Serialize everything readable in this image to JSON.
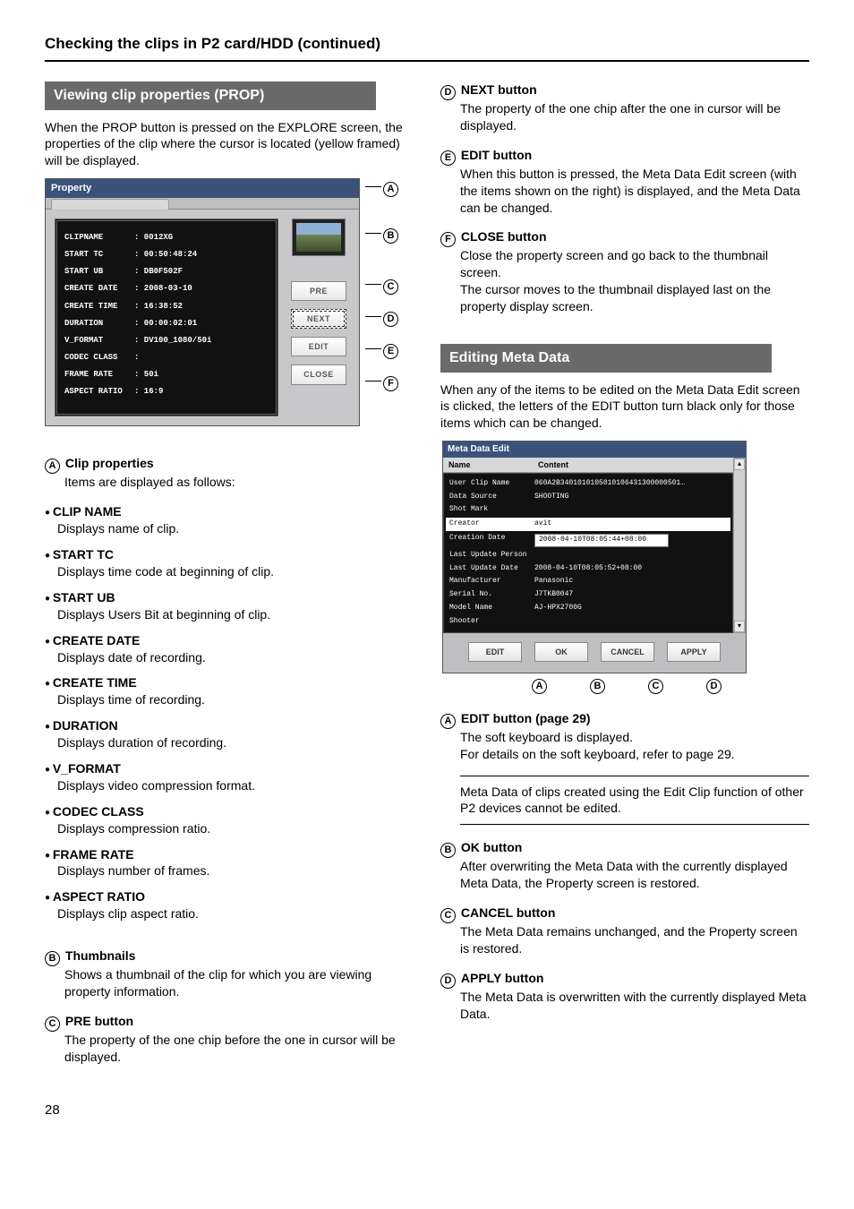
{
  "page_title": "Checking the clips in P2 card/HDD (continued)",
  "page_number": "28",
  "left": {
    "heading": "Viewing clip properties (PROP)",
    "intro": "When the PROP button is pressed on the EXPLORE screen, the properties of the clip where the cursor is located (yellow framed) will be displayed.",
    "window_title": "Property",
    "buttons": {
      "pre": "PRE",
      "next": "NEXT",
      "edit": "EDIT",
      "close": "CLOSE"
    },
    "rows": [
      {
        "k": "CLIPNAME",
        "v": ": 0012XG"
      },
      {
        "k": "START TC",
        "v": ": 00:50:48:24"
      },
      {
        "k": "START UB",
        "v": ": DB0F502F"
      },
      {
        "k": "CREATE DATE",
        "v": ": 2008-03-10"
      },
      {
        "k": "CREATE TIME",
        "v": ": 16:38:52"
      },
      {
        "k": "DURATION",
        "v": ": 00:00:02:01"
      },
      {
        "k": "V_FORMAT",
        "v": ": DV100_1080/50i"
      },
      {
        "k": "CODEC CLASS",
        "v": ":"
      },
      {
        "k": "FRAME RATE",
        "v": ": 50i"
      },
      {
        "k": "ASPECT RATIO",
        "v": ": 16:9"
      }
    ],
    "items": [
      {
        "label": "Clip properties",
        "desc": "Items are displayed as follows:"
      },
      {
        "label": "Thumbnails",
        "desc": "Shows a thumbnail of the clip for which you are viewing property information."
      },
      {
        "label": "PRE button",
        "desc": "The property of the one chip before the one in cursor will be displayed."
      }
    ],
    "props": [
      {
        "name": "CLIP NAME",
        "desc": "Displays name of clip."
      },
      {
        "name": "START TC",
        "desc": "Displays time code at beginning of clip."
      },
      {
        "name": "START UB",
        "desc": "Displays Users Bit at beginning of clip."
      },
      {
        "name": "CREATE DATE",
        "desc": "Displays date of recording."
      },
      {
        "name": "CREATE TIME",
        "desc": "Displays time of recording."
      },
      {
        "name": "DURATION",
        "desc": "Displays duration of recording."
      },
      {
        "name": "V_FORMAT",
        "desc": "Displays video compression format."
      },
      {
        "name": "CODEC CLASS",
        "desc": "Displays compression ratio."
      },
      {
        "name": "FRAME RATE",
        "desc": "Displays number of frames."
      },
      {
        "name": "ASPECT RATIO",
        "desc": "Displays clip aspect ratio."
      }
    ]
  },
  "right": {
    "d_label": "NEXT button",
    "d_desc": "The property of the one chip after the one in cursor will be displayed.",
    "e_label": "EDIT button",
    "e_desc": "When this button is pressed, the Meta Data Edit screen (with the items shown on the right) is displayed, and the Meta Data can be changed.",
    "f_label": "CLOSE button",
    "f_desc1": "Close the property screen and go back to the thumbnail screen.",
    "f_desc2": "The cursor moves to the thumbnail displayed last on the property display screen.",
    "heading2": "Editing Meta Data",
    "intro2": "When any of the items to be edited on the Meta Data Edit screen is clicked, the letters of the EDIT button turn black only for those items which can be changed.",
    "meta_title": "Meta Data Edit",
    "meta_header_name": "Name",
    "meta_header_content": "Content",
    "meta_rows": [
      {
        "k": "User Clip Name",
        "v": "060A2B3401010105010106431300000501…",
        "hot": false
      },
      {
        "k": "Data Source",
        "v": "SHOOTING",
        "hot": false
      },
      {
        "k": "Shot Mark",
        "v": "",
        "hot": false
      },
      {
        "k": "Creator",
        "v": "avit",
        "white": true
      },
      {
        "k": "Creation Date",
        "v": "2008-04-10T08:05:44+08:00",
        "edit": true
      },
      {
        "k": "Last Update Person",
        "v": "",
        "hot": false
      },
      {
        "k": "Last Update Date",
        "v": "2008-04-10T08:05:52+08:00",
        "hot": false
      },
      {
        "k": "Manufacturer",
        "v": "Panasonic",
        "hot": false
      },
      {
        "k": "Serial No.",
        "v": "J7TKB0047",
        "hot": false
      },
      {
        "k": "Model Name",
        "v": "AJ-HPX2700G",
        "hot": false
      },
      {
        "k": "Shooter",
        "v": "",
        "hot": false
      }
    ],
    "meta_buttons": {
      "edit": "EDIT",
      "ok": "OK",
      "cancel": "CANCEL",
      "apply": "APPLY"
    },
    "items2": [
      {
        "c": "A",
        "label": "EDIT button (page 29)",
        "desc1": "The soft keyboard is displayed.",
        "desc2": "For details on the soft keyboard, refer to page 29."
      },
      {
        "c": "B",
        "label": "OK button",
        "desc1": "After overwriting the Meta Data with the currently displayed Meta Data, the Property screen is restored."
      },
      {
        "c": "C",
        "label": "CANCEL button",
        "desc1": "The Meta Data remains unchanged, and the Property screen is restored."
      },
      {
        "c": "D",
        "label": "APPLY button",
        "desc1": "The Meta Data is overwritten with the currently displayed Meta Data."
      }
    ],
    "note": "Meta Data of clips created using the Edit Clip function of other P2 devices cannot be edited."
  }
}
